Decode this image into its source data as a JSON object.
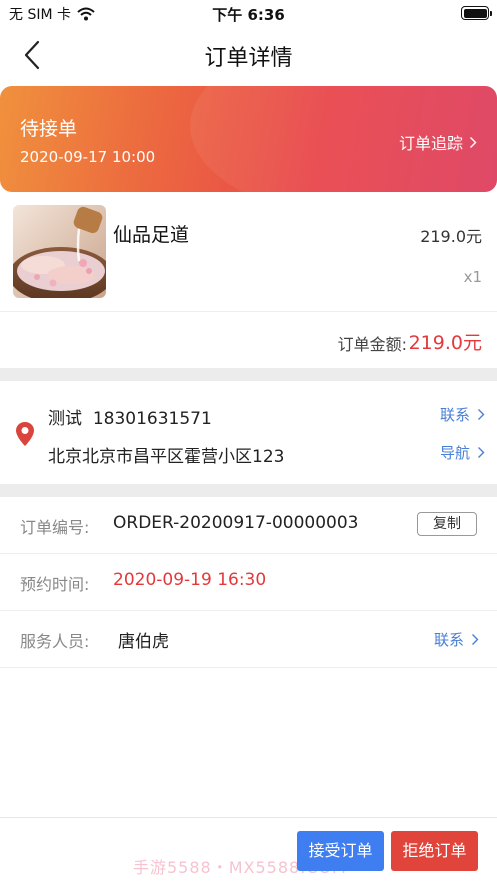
{
  "status_bar": {
    "carrier": "无 SIM 卡",
    "time": "下午 6:36"
  },
  "nav": {
    "title": "订单详情"
  },
  "banner": {
    "status": "待接单",
    "datetime": "2020-09-17 10:00",
    "track_label": "订单追踪"
  },
  "product": {
    "name": "仙品足道",
    "price": "219.0元",
    "quantity": "x1"
  },
  "total": {
    "label": "订单金额:",
    "value": "219.0元"
  },
  "address": {
    "contact_name": "测试",
    "phone": "18301631571",
    "full_address": "北京北京市昌平区霍营小区123",
    "contact_link": "联系",
    "navigate_link": "导航"
  },
  "order_info": {
    "number_label": "订单编号:",
    "number_value": "ORDER-20200917-00000003",
    "copy_label": "复制",
    "appointment_label": "预约时间:",
    "appointment_value": "2020-09-19 16:30",
    "staff_label": "服务人员:",
    "staff_value": "唐伯虎",
    "staff_contact": "联系"
  },
  "actions": {
    "accept": "接受订单",
    "reject": "拒绝订单"
  },
  "watermark": "手游5588・MX5588.COM",
  "colors": {
    "accent_red": "#e4393c",
    "link_blue": "#4a7fd6",
    "accept_button": "#3f7ef0",
    "reject_button": "#e0443a"
  }
}
